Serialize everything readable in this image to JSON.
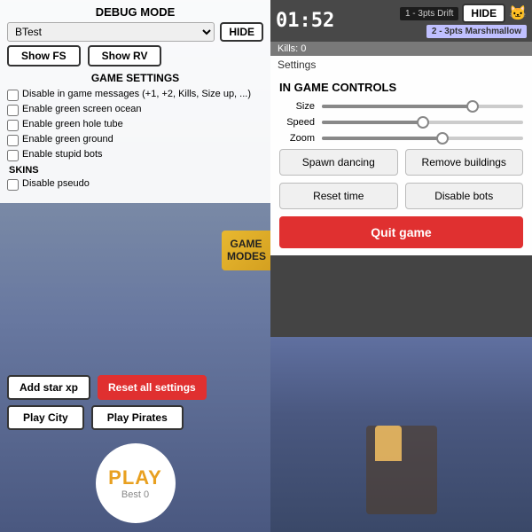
{
  "left": {
    "debug_title": "DEBUG MODE",
    "hide_label": "HIDE",
    "dropdown_value": "BTest",
    "show_fs_label": "Show FS",
    "show_rv_label": "Show RV",
    "game_settings_title": "GAME SETTINGS",
    "checkboxes": [
      {
        "label": "Disable in game messages (+1, +2, Kills, Size up, ...)",
        "checked": false
      },
      {
        "label": "Enable green screen ocean",
        "checked": false
      },
      {
        "label": "Enable green hole tube",
        "checked": false
      },
      {
        "label": "Enable green ground",
        "checked": false
      },
      {
        "label": "Enable stupid bots",
        "checked": false
      },
      {
        "label": "Disable pseudo",
        "checked": false
      }
    ],
    "skins_label": "SKINS",
    "game_modes_label": "GAME\nMODES",
    "add_star_xp_label": "Add star xp",
    "reset_all_settings_label": "Reset all settings",
    "play_city_label": "Play City",
    "play_pirates_label": "Play Pirates",
    "play_label": "PLAY",
    "best_label": "Best 0"
  },
  "right": {
    "timer": "01:52",
    "hide_label": "HIDE",
    "drift_label": "1 - 3pts Drift",
    "marshmallow_label": "2 - 3pts Marshmallow",
    "kills_label": "Kills: 0",
    "settings_label": "Settings",
    "size_label": "Size",
    "speed_label": "Speed",
    "zoom_label": "Zoom",
    "size_fill": 75,
    "speed_fill": 50,
    "zoom_fill": 60,
    "igc_title": "IN GAME CONTROLS",
    "spawn_dancing_label": "Spawn dancing",
    "remove_buildings_label": "Remove buildings",
    "reset_time_label": "Reset time",
    "disable_bots_label": "Disable bots",
    "quit_game_label": "Quit game"
  }
}
